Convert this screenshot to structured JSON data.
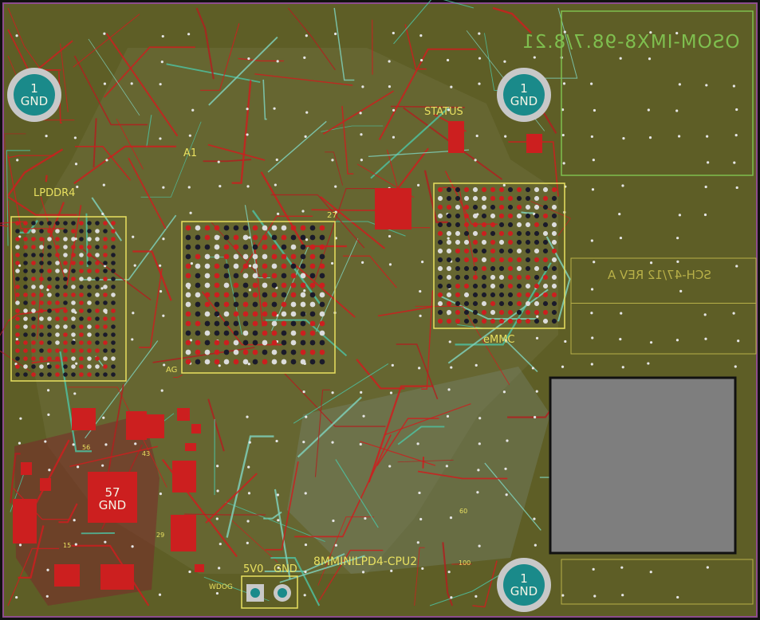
{
  "colors": {
    "board": "#5e5e26",
    "copper_top": "#cc1f1f",
    "trace_alt": "#4fbf9f",
    "silk": "#e8e060",
    "outline": "#c8c8c8",
    "keepout": "#7e7e7e"
  },
  "labels": {
    "a1": "A1",
    "lpddr4": "LPDDR4",
    "status": "STATUS",
    "emmc": "eMMC",
    "pin27": "27",
    "ag": "AG",
    "part_number_top": "OSOM-IMX8-98.7/8.21",
    "schematic_ref": "SCH-47/12 REV A",
    "board_name": "8MMINILPD4-CPU2",
    "v5": "5V0",
    "gnd": "GND",
    "wdog": "WDOG",
    "n56": "56",
    "n43": "43",
    "n15": "15",
    "n29": "29",
    "n60": "60",
    "n100": "100"
  },
  "mount_holes": [
    {
      "net_num": "1",
      "net": "GND"
    },
    {
      "net_num": "1",
      "net": "GND"
    },
    {
      "net_num": "1",
      "net": "GND"
    }
  ],
  "center_pad": {
    "net_num": "57",
    "net": "GND"
  },
  "connector": {
    "pins": [
      "5V0",
      "GND"
    ]
  }
}
